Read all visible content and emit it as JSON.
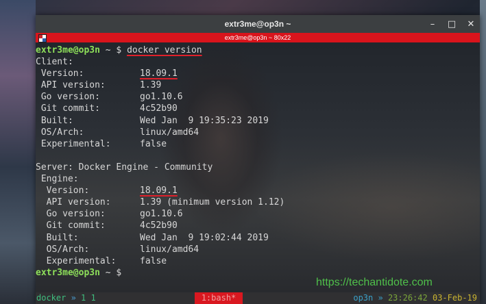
{
  "window": {
    "title": "extr3me@op3n ~",
    "buttons": {
      "minimize": "–",
      "maximize": "□",
      "close": "✕"
    }
  },
  "tab": {
    "title": "extr3me@op3n ~ 80x22",
    "icon": "terminal-app-icon"
  },
  "prompt": {
    "user_host": "extr3me@op3n",
    "path_symbol": " ~ $ "
  },
  "terminal": {
    "command": "docker version",
    "client_header": "Client:",
    "client": [
      {
        "key": " Version:",
        "value": "18.09.1",
        "underline": true
      },
      {
        "key": " API version:",
        "value": "1.39"
      },
      {
        "key": " Go version:",
        "value": "go1.10.6"
      },
      {
        "key": " Git commit:",
        "value": "4c52b90"
      },
      {
        "key": " Built:",
        "value": "Wed Jan  9 19:35:23 2019"
      },
      {
        "key": " OS/Arch:",
        "value": "linux/amd64"
      },
      {
        "key": " Experimental:",
        "value": "false"
      }
    ],
    "server_header": "Server: Docker Engine - Community",
    "engine_header": " Engine:",
    "server": [
      {
        "key": "  Version:",
        "value": "18.09.1",
        "underline": true
      },
      {
        "key": "  API version:",
        "value": "1.39 (minimum version 1.12)"
      },
      {
        "key": "  Go version:",
        "value": "go1.10.6"
      },
      {
        "key": "  Git commit:",
        "value": "4c52b90"
      },
      {
        "key": "  Built:",
        "value": "Wed Jan  9 19:02:44 2019"
      },
      {
        "key": "  OS/Arch:",
        "value": "linux/amd64"
      },
      {
        "key": "  Experimental:",
        "value": "false"
      }
    ]
  },
  "watermark": "https://techantidote.com",
  "statusbar": {
    "session": "docker",
    "arrow": " » ",
    "windows": "1 1",
    "active_window": "1:bash*",
    "host": "op3n",
    "sep": " » ",
    "time": "23:26:42",
    "date": "03-Feb-19"
  },
  "colors": {
    "tab_bar": "#d9141c",
    "prompt_user": "#8ee05a",
    "underline": "#e0202a",
    "watermark": "#4fc04a"
  }
}
